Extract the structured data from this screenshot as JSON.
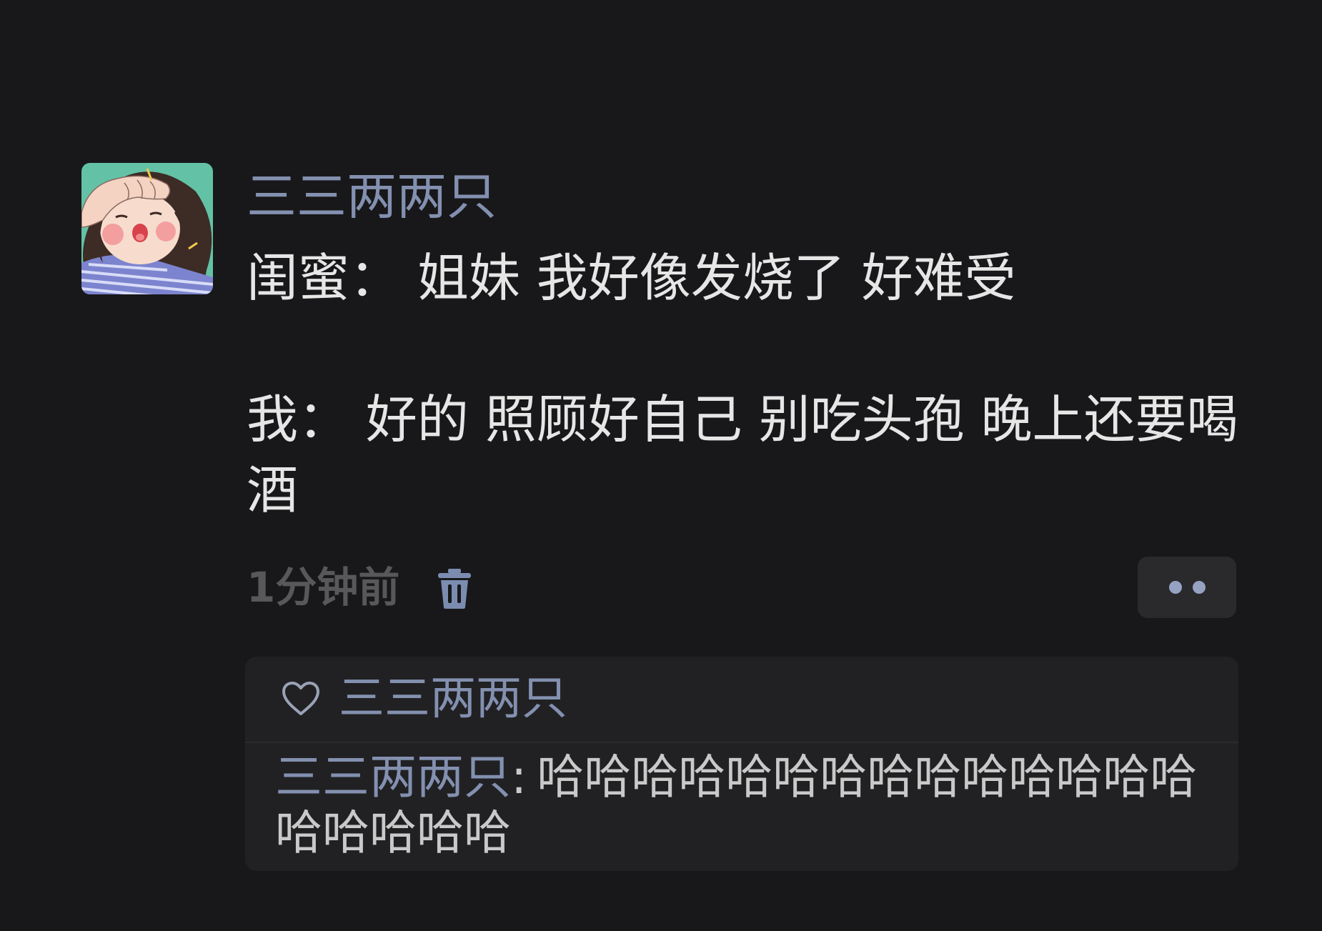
{
  "theme": {
    "background": "#18181a",
    "author_color": "#8390b0",
    "message_color": "#e6e6e6",
    "timestamp_color": "#58585a",
    "icon_color": "#7b8cb0",
    "more_button_bg": "#2a2a2c",
    "more_dots_color": "#95a2c2",
    "comment_box_bg": "#212123",
    "divider_color": "#2b2b2d",
    "heart_color": "#9aa2b6",
    "comment_text_color": "#c9c9c9"
  },
  "post": {
    "avatar_icon": "avatar-illustration",
    "author": "三三两两只",
    "message": "闺蜜： 姐妹 我好像发烧了 好难受\n\n我： 好的 照顾好自己 别吃头孢 晚上还要喝酒",
    "timestamp": "1分钟前",
    "delete_icon": "trash-icon",
    "more_icon": "more-dots-icon"
  },
  "likes": {
    "icon": "heart-icon",
    "names": "三三两两只"
  },
  "comments": [
    {
      "author": "三三两两只",
      "separator": ":",
      "text": "哈哈哈哈哈哈哈哈哈哈哈哈哈哈哈哈哈哈哈"
    }
  ]
}
